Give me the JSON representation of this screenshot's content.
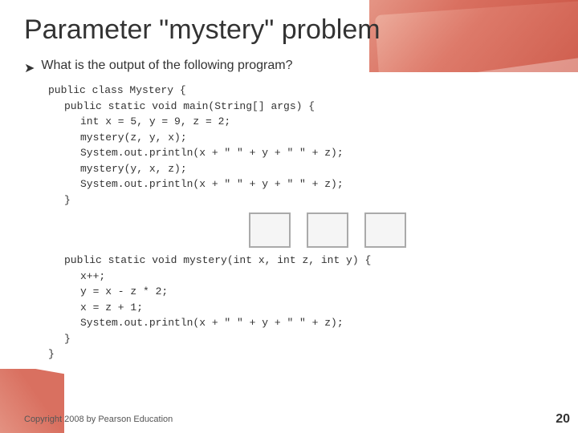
{
  "slide": {
    "title": "Parameter \"mystery\" problem",
    "bullet": "What is the output of the following program?",
    "code_block_1": [
      "public class Mystery {",
      "    public static void main(String[] args) {",
      "        int x = 5, y = 9, z = 2;",
      "        mystery(z, y, x);",
      "        System.out.println(x + \" \" + y + \" \" + z);",
      "        mystery(y, x, z);",
      "        System.out.println(x + \" \" + y + \" \" + z);",
      "    }"
    ],
    "code_block_2": [
      "    public static void mystery(int x, int z, int y) {",
      "        x++;",
      "        y = x - z * 2;",
      "        x = z + 1;",
      "        System.out.println(x + \" \" + y + \" \" + z);",
      "    }",
      "}"
    ],
    "footer": {
      "copyright": "Copyright 2008 by Pearson Education",
      "page_number": "20"
    }
  }
}
